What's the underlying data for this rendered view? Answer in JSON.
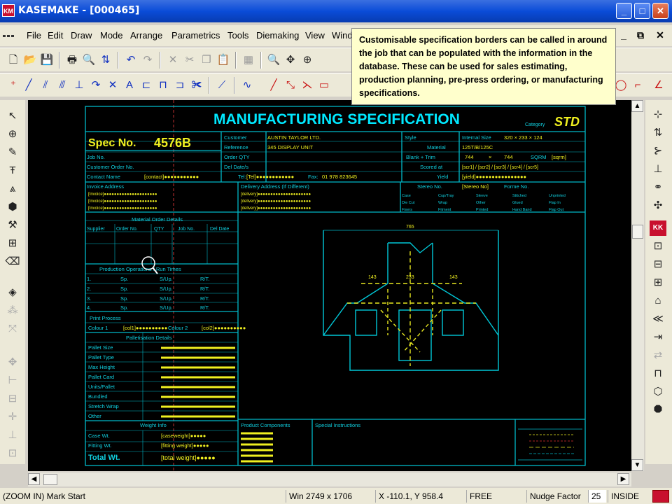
{
  "window": {
    "title": "KASEMAKE - [000465]",
    "app_icon_text": "KM",
    "controls": [
      "_",
      "□",
      "✕"
    ]
  },
  "menu": {
    "items": [
      "File",
      "Edit",
      "Draw",
      "Mode",
      "Arrange",
      "Parametrics",
      "Tools",
      "Diemaking",
      "View",
      "Windo"
    ],
    "mdi_controls": [
      "_",
      "⧉",
      "✕"
    ]
  },
  "tooltip": {
    "text": "Customisable specification borders can be called in around the job that can be populated with the information in the database. These can be used for sales estimating, production planning, pre-press ordering, or manufacturing specifications."
  },
  "spec": {
    "title": "MANUFACTURING SPECIFICATION",
    "category_label": "Category",
    "category_value": "STD",
    "spec_label": "Spec No.",
    "spec_number": "4576B",
    "customer_label": "Customer",
    "customer_value": "AUSTIN TAYLOR LTD.",
    "reference_label": "Reference",
    "reference_value": "345 DISPLAY UNIT",
    "order_qty_label": "Order QTY",
    "del_dates_label": "Del Date/s",
    "tel_label": "Tel:",
    "tel_value": "[Tel]●●●●●●●●●●●●",
    "fax_label": "Fax:",
    "fax_value": "01 978 823645",
    "style_label": "Style",
    "internal_size_label": "Internal Size",
    "internal_size_value": "320 × 233 × 124",
    "material_label": "Material",
    "material_value": "125T/B/125C",
    "blank_trim_label": "Blank + Trim",
    "blank_w": "744",
    "blank_x": "×",
    "blank_h": "744",
    "sqrm_label": "SQRM",
    "sqrm_value": "[sqrm]",
    "scored_label": "Scored at",
    "scored_value": "[scr1] / [scr2] / [scr3] / [scr4] / [scr5]",
    "yield_label": "Yield",
    "yield_value": "[yield]●●●●●●●●●●●●●●●●",
    "stereo_label": "Stereo No.",
    "stereo_value": "[Stereo No]",
    "forme_label": "Forme No.",
    "job_no_label": "Job No.",
    "cust_order_label": "Customer Order No.",
    "contact_label": "Contact Name",
    "contact_value": "[contact]●●●●●●●●●●●",
    "invoice_label": "Invoice Address",
    "delivery_label": "Delivery Address (If Different)",
    "invoice_lines": [
      "[Invoice]●●●●●●●●●●●●●●●●●●●●●",
      "[Invoice]●●●●●●●●●●●●●●●●●●●●●",
      "[Invoice]●●●●●●●●●●●●●●●●●●●●●"
    ],
    "delivery_lines": [
      "[delivery]●●●●●●●●●●●●●●●●●●●●●",
      "[delivery]●●●●●●●●●●●●●●●●●●●●●",
      "[delivery]●●●●●●●●●●●●●●●●●●●●●"
    ],
    "checks": [
      "Case",
      "Cup/Tray",
      "Sleeve",
      "Stitched",
      "Unprinted",
      "Die Cut",
      "Wrap",
      "Other",
      "Glued",
      "Flap In",
      "Fixers",
      "Fitment",
      "Printed",
      "Hand Band",
      "Flap Out"
    ],
    "material_order_label": "Material Order Details",
    "material_order_cols": [
      "Supplier",
      "Order No.",
      "QTY",
      "Job No.",
      "Del Date"
    ],
    "production_label": "Production Operations / Run Times",
    "production_rows": [
      {
        "n": "1.",
        "sp": "Sp.",
        "up": "S/Up.",
        "rt": "R/T."
      },
      {
        "n": "2.",
        "sp": "Sp.",
        "up": "S/Up.",
        "rt": "R/T."
      },
      {
        "n": "3.",
        "sp": "Sp.",
        "up": "S/Up.",
        "rt": "R/T."
      },
      {
        "n": "4.",
        "sp": "Sp.",
        "up": "S/Up.",
        "rt": "R/T."
      }
    ],
    "print_process_label": "Print Process",
    "colour1_label": "Colour 1",
    "colour1_value": "[col1]●●●●●●●●●●",
    "colour2_label": "Colour 2",
    "colour2_value": "[col2]●●●●●●●●●●",
    "palletisation_label": "Palletisation Details",
    "pallet_rows": [
      "Pallet Size",
      "Pallet Type",
      "Max Height",
      "Pallet Card",
      "Units/Pallet",
      "Bundled",
      "Stretch Wrap",
      "Other"
    ],
    "weight_label": "Weight Info",
    "case_wt_label": "Case Wt.",
    "case_wt_value": "[caseweight]●●●●●",
    "fitting_wt_label": "Fitting Wt.",
    "fitting_wt_value": "[fitting weight]●●●●●",
    "total_wt_label": "Total Wt.",
    "total_wt_value": "[total weight]●●●●●",
    "components_label": "Product Components",
    "instructions_label": "Special Instructions",
    "dim_top": "765",
    "dim_flaps": [
      "143",
      "233",
      "143"
    ]
  },
  "status": {
    "hint": "(ZOOM IN) Mark Start",
    "window_size": "Win 2749 x 1706",
    "coords": "X -110.1, Y 958.4",
    "mode": "FREE",
    "nudge_label": "Nudge Factor",
    "nudge_value": "25",
    "insert_mode": "INSIDE"
  },
  "colors": {
    "title_cyan": "#00e8ff",
    "line_cyan": "#00b8c8",
    "text_yellow": "#f0f020",
    "label_cyan": "#10d0e0"
  }
}
